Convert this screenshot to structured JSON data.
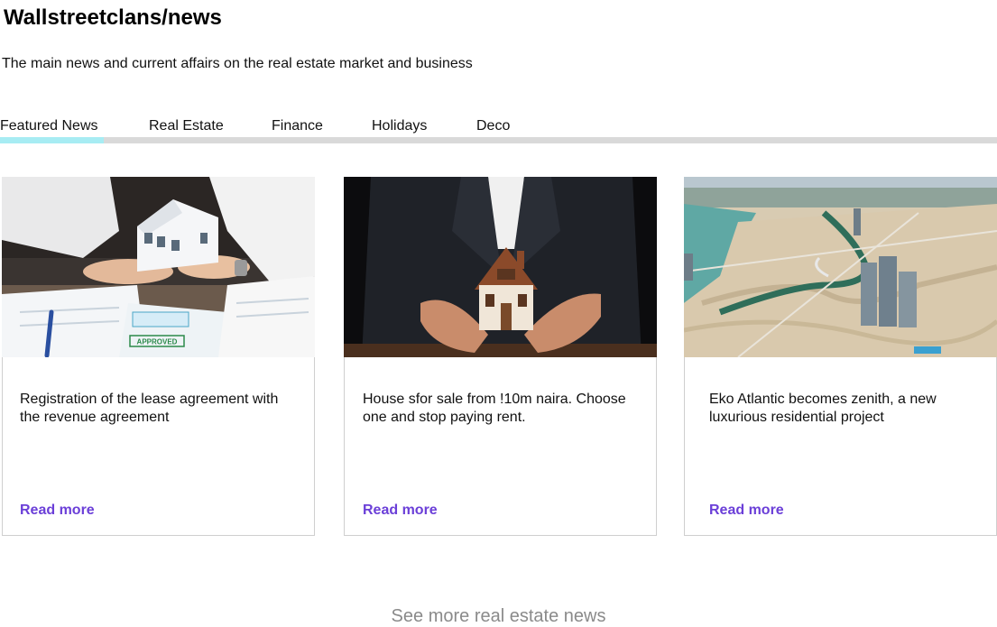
{
  "header": {
    "title": "Wallstreetclans/news",
    "subtitle": "The main news and current affairs on the real estate market and business"
  },
  "tabs": [
    {
      "label": "Featured News",
      "active": true
    },
    {
      "label": "Real Estate",
      "active": false
    },
    {
      "label": "Finance",
      "active": false
    },
    {
      "label": "Holidays",
      "active": false
    },
    {
      "label": "Deco",
      "active": false
    }
  ],
  "cards": [
    {
      "image": "lease-agreement-signing-photo",
      "image_text": {
        "stamp": "APPROVED"
      },
      "title": "Registration of the lease agreement with the revenue agreement",
      "link": "Read more"
    },
    {
      "image": "house-model-in-hands-photo",
      "title": "House sfor sale from !10m naira. Choose one and stop paying rent.",
      "link": "Read more"
    },
    {
      "image": "eko-atlantic-aerial-photo",
      "title": "Eko Atlantic becomes zenith, a new luxurious residential  project",
      "link": "Read more"
    }
  ],
  "footer": {
    "see_more": "See more real estate news"
  },
  "colors": {
    "link": "#6b3fd8",
    "tab_indicator": "#a7ecf3",
    "tab_track": "#d9d9d9",
    "see_more": "#8a8a8a"
  }
}
